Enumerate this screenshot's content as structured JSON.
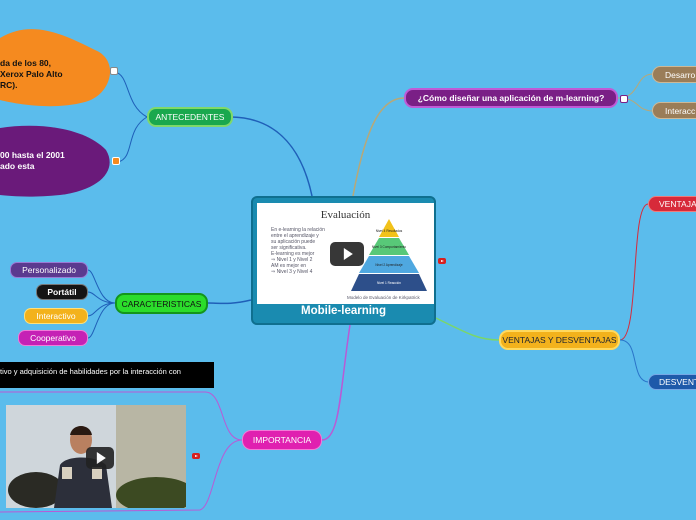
{
  "central": {
    "title": "Mobile-learning",
    "slide": {
      "title": "Evaluación",
      "bullets": [
        "En e-learning la relación",
        "entre el aprendizaje y",
        "su aplicación puede",
        "ser significativa.",
        "E-learning es mejor",
        "⇒ Nivel 1 y Nivel 2",
        "AM es mejor en",
        "⇒ Nivel 3 y Nivel 4"
      ],
      "pyramid_levels": [
        "Nivel 4 Resultados",
        "Nivel 3 Comportamiento",
        "Nivel 2 Aprendizaje",
        "Nivel 1 Reacción"
      ],
      "caption": "Modelo de Evaluación de Kirkpatrick"
    }
  },
  "antecedentes": {
    "label": "ANTECEDENTES",
    "blob1_lines": [
      "da de los 80,",
      "Xerox Palo Alto",
      "RC)."
    ],
    "blob2_lines": [
      "00 hasta el 2001",
      "ado esta"
    ]
  },
  "caracteristicas": {
    "label": "CARACTERISTICAS",
    "items": [
      "Personalizado",
      "Portátil",
      "Interactivo",
      "Cooperativo"
    ]
  },
  "importancia": {
    "label": "IMPORTANCIA",
    "topic_text": "tivo y  adquisición de habilidades por la interacción con"
  },
  "diseno": {
    "label": "¿Cómo diseñar una aplicación de m-learning?",
    "items": [
      "Desarro",
      "Interacc"
    ]
  },
  "ventajas": {
    "label": "VENTAJAS Y DESVENTAJAS",
    "items": [
      "VENTAJAS",
      "DESVENTA"
    ]
  },
  "colors": {
    "background": "#5bbcec",
    "central": "#1a8bb0",
    "antecedentes": "#1aa84e",
    "diseno": "#7a1f86",
    "ventajas": "#f3b21c",
    "caracteristicas": "#2bdc2b",
    "importancia": "#e020b0",
    "blob_orange": "#f58a1f",
    "blob_purple": "#6a1a7a"
  },
  "icons": [
    "play-icon",
    "youtube-icon",
    "link-icon",
    "note-icon"
  ]
}
